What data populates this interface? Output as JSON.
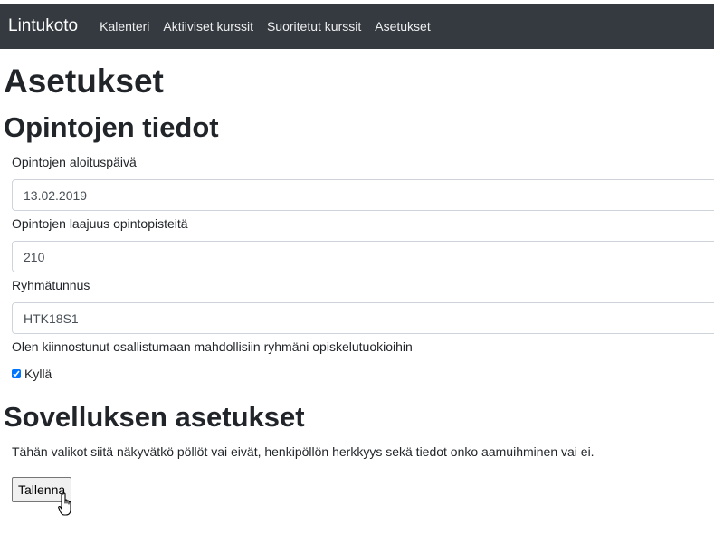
{
  "navbar": {
    "brand": "Lintukoto",
    "links": [
      "Kalenteri",
      "Aktiiviset kurssit",
      "Suoritetut kurssit",
      "Asetukset"
    ]
  },
  "page": {
    "title": "Asetukset"
  },
  "study": {
    "heading": "Opintojen tiedot",
    "start_date_label": "Opintojen aloituspäivä",
    "start_date_value": "13.02.2019",
    "credits_label": "Opintojen laajuus opintopisteitä",
    "credits_value": "210",
    "group_label": "Ryhmätunnus",
    "group_value": "HTK18S1",
    "interest_label": "Olen kiinnostunut osallistumaan mahdollisiin ryhmäni opiskelutuokioihin",
    "interest_checkbox_label": "Kyllä",
    "interest_checked": true
  },
  "app_settings": {
    "heading": "Sovelluksen asetukset",
    "description": "Tähän valikot siitä näkyvätkö pöllöt vai eivät, henkipöllön herkkyys sekä tiedot onko aamuihminen vai ei.",
    "save_label": "Tallenna"
  },
  "colors": {
    "navbar_bg": "#343a40",
    "input_border": "#ced4da"
  },
  "icons": {
    "cursor": "hand-pointer-icon"
  }
}
